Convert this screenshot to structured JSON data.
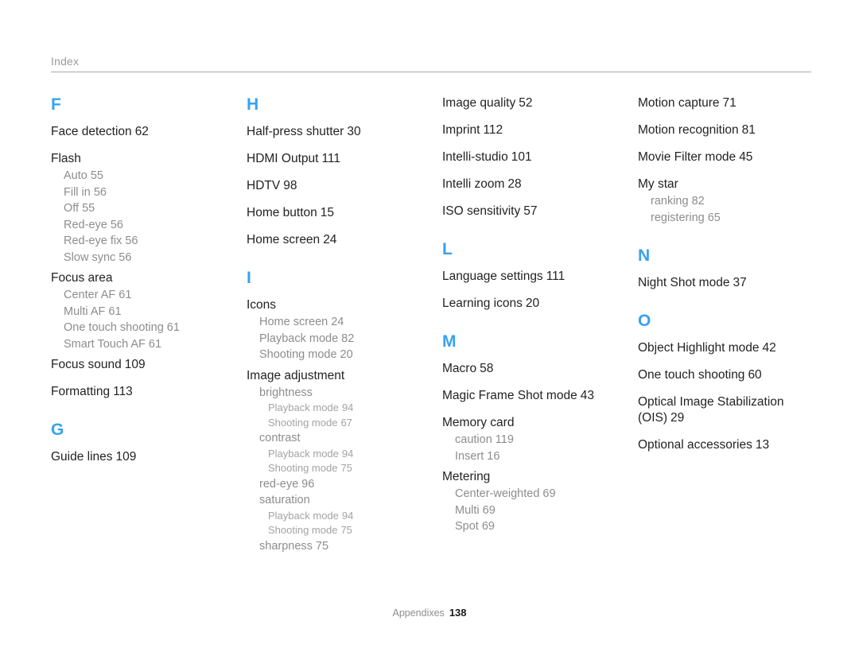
{
  "header": {
    "label": "Index"
  },
  "footer": {
    "label": "Appendixes",
    "page_number": "138"
  },
  "colors": {
    "letter_heading": "#38a1f2",
    "main_entry": "#232323",
    "sub_entry": "#8d8d8d",
    "sub_sub_entry": "#a3a3a3",
    "rule": "#a9a9a9",
    "header_label": "#9a9a9a"
  },
  "columns": [
    {
      "id": "column-1",
      "blocks": [
        {
          "type": "letter",
          "label": "F"
        },
        {
          "type": "entry",
          "text": "Face detection",
          "page": "62"
        },
        {
          "type": "entry",
          "text": "Flash",
          "page": "",
          "subs": [
            {
              "text": "Auto",
              "page": "55"
            },
            {
              "text": "Fill in",
              "page": "56"
            },
            {
              "text": "Off",
              "page": "55"
            },
            {
              "text": "Red-eye",
              "page": "56"
            },
            {
              "text": "Red-eye fix",
              "page": "56"
            },
            {
              "text": "Slow sync",
              "page": "56"
            }
          ]
        },
        {
          "type": "entry",
          "text": "Focus area",
          "page": "",
          "subs": [
            {
              "text": "Center AF",
              "page": "61"
            },
            {
              "text": "Multi AF",
              "page": "61"
            },
            {
              "text": "One touch shooting",
              "page": "61"
            },
            {
              "text": "Smart Touch AF",
              "page": "61"
            }
          ]
        },
        {
          "type": "entry",
          "text": "Focus sound",
          "page": "109"
        },
        {
          "type": "entry",
          "text": "Formatting",
          "page": "113"
        },
        {
          "type": "letter",
          "label": "G"
        },
        {
          "type": "entry",
          "text": "Guide lines",
          "page": "109"
        }
      ]
    },
    {
      "id": "column-2",
      "blocks": [
        {
          "type": "letter",
          "label": "H"
        },
        {
          "type": "entry",
          "text": "Half-press shutter",
          "page": "30"
        },
        {
          "type": "entry",
          "text": "HDMI Output",
          "page": "111"
        },
        {
          "type": "entry",
          "text": "HDTV",
          "page": "98"
        },
        {
          "type": "entry",
          "text": "Home button",
          "page": "15"
        },
        {
          "type": "entry",
          "text": "Home screen",
          "page": "24"
        },
        {
          "type": "letter",
          "label": "I"
        },
        {
          "type": "entry",
          "text": "Icons",
          "page": "",
          "subs": [
            {
              "text": "Home screen",
              "page": "24"
            },
            {
              "text": "Playback mode",
              "page": "82"
            },
            {
              "text": "Shooting mode",
              "page": "20"
            }
          ]
        },
        {
          "type": "entry",
          "text": "Image adjustment",
          "page": "",
          "subs": [
            {
              "text": "brightness",
              "page": "",
              "subs2": [
                {
                  "text": "Playback mode",
                  "page": "94"
                },
                {
                  "text": "Shooting mode",
                  "page": "67"
                }
              ]
            },
            {
              "text": "contrast",
              "page": "",
              "subs2": [
                {
                  "text": "Playback mode",
                  "page": "94"
                },
                {
                  "text": "Shooting mode",
                  "page": "75"
                }
              ]
            },
            {
              "text": "red-eye",
              "page": "96"
            },
            {
              "text": "saturation",
              "page": "",
              "subs2": [
                {
                  "text": "Playback mode",
                  "page": "94"
                },
                {
                  "text": "Shooting mode",
                  "page": "75"
                }
              ]
            },
            {
              "text": "sharpness",
              "page": "75"
            }
          ]
        }
      ]
    },
    {
      "id": "column-3",
      "blocks": [
        {
          "type": "entry",
          "text": "Image quality",
          "page": "52"
        },
        {
          "type": "entry",
          "text": "Imprint",
          "page": "112"
        },
        {
          "type": "entry",
          "text": "Intelli-studio",
          "page": "101"
        },
        {
          "type": "entry",
          "text": "Intelli zoom",
          "page": "28"
        },
        {
          "type": "entry",
          "text": "ISO sensitivity",
          "page": "57"
        },
        {
          "type": "letter",
          "label": "L"
        },
        {
          "type": "entry",
          "text": "Language settings",
          "page": "111"
        },
        {
          "type": "entry",
          "text": "Learning icons",
          "page": "20"
        },
        {
          "type": "letter",
          "label": "M"
        },
        {
          "type": "entry",
          "text": "Macro",
          "page": "58"
        },
        {
          "type": "entry",
          "text": "Magic Frame Shot mode",
          "page": "43"
        },
        {
          "type": "entry",
          "text": "Memory card",
          "page": "",
          "subs": [
            {
              "text": "caution",
              "page": "119"
            },
            {
              "text": "Insert",
              "page": "16"
            }
          ]
        },
        {
          "type": "entry",
          "text": "Metering",
          "page": "",
          "subs": [
            {
              "text": "Center-weighted",
              "page": "69"
            },
            {
              "text": "Multi",
              "page": "69"
            },
            {
              "text": "Spot",
              "page": "69"
            }
          ]
        }
      ]
    },
    {
      "id": "column-4",
      "blocks": [
        {
          "type": "entry",
          "text": "Motion capture",
          "page": "71"
        },
        {
          "type": "entry",
          "text": "Motion recognition",
          "page": "81"
        },
        {
          "type": "entry",
          "text": "Movie Filter mode",
          "page": "45"
        },
        {
          "type": "entry",
          "text": "My star",
          "page": "",
          "subs": [
            {
              "text": "ranking",
              "page": "82"
            },
            {
              "text": "registering",
              "page": "65"
            }
          ]
        },
        {
          "type": "letter",
          "label": "N"
        },
        {
          "type": "entry",
          "text": "Night Shot mode",
          "page": "37"
        },
        {
          "type": "letter",
          "label": "O"
        },
        {
          "type": "entry",
          "text": "Object Highlight mode",
          "page": "42"
        },
        {
          "type": "entry",
          "text": "One touch shooting",
          "page": "60"
        },
        {
          "type": "entry",
          "text": "Optical Image Stabilization (OIS)",
          "page": "29"
        },
        {
          "type": "entry",
          "text": "Optional accessories",
          "page": "13"
        }
      ]
    }
  ]
}
